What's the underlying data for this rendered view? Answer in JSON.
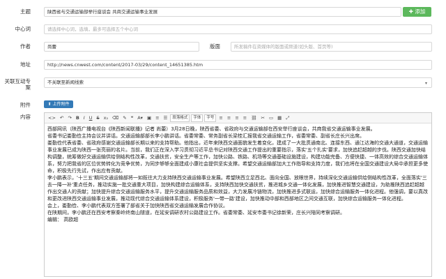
{
  "labels": {
    "title": "主题",
    "keywords": "中心词",
    "author": "作者",
    "layout": "版面",
    "url": "地址",
    "related": "关联互动专\n案",
    "attachment": "附件",
    "content": "内容"
  },
  "fields": {
    "title_value": "陕西省与交通运输部举行座谈会 共商交通运输事业发展",
    "keywords_placeholder": "请选择中心词，选填，最多可选择五个中心词",
    "author_value": "尚蕾",
    "layout_placeholder": "所发稿件在资媒体的版面或频道(如头版、首页等)",
    "url_value": "http://news.cnwest.com/content/2017-03/29/content_14651385.htm",
    "related_value": "不关联至新闻线索"
  },
  "buttons": {
    "add": "添加",
    "upload": "上传附件"
  },
  "toolbar": {
    "para_format": "段落格式",
    "font_family": "字体",
    "font_size": "字号"
  },
  "content": {
    "paragraphs": [
      "西部网讯（陕西广播电视台《陕西新闻联播》记者 尚蕾）3月28日晚，陕西省委、省政府与交通运输部在西安举行座谈会，共商我省交通运输事业发展。",
      "省委书记娄勤俭主持会议并讲话。交通运输部部长李小鹏讲话。省委常委、常务副省长梁桂汇报我省交通运输工作，省委常委、副省长庄长兴出席。",
      "娄勤俭代表省委、省政府感谢交通运输部长期以来的支持帮助。他指出，近年来陕西交通面貌发生着变化，建成了一大批贯通南北、连接东西、通江达海的交通大通道，交通运输事业发展已成为陕西一张亮丽的名片。当前，我们正在深入学习贯彻习近平总书记对陕西交通工作提出的重要指示，落实'五个扎实'要求，加快追赶超越的步伐。陕西交通加快结构调整，统筹做好交通运输供给侧结构性改革，交通扶贫，安全生产等工作，加快公路、铁路、机场等交通基础设施建设，构建功能完备、方便快捷、一体高效的综合交通运输体系，努力把我省的区位优势转化为竞争优势，为同步够够全面建成小康社会提供坚实支撑。希望交通运输部加大工作指导和支持力度，我们也将在全国交通建设大局中承担更多使命，积极先行先试，作出应有贡献。",
      "李小鹏表示，'十三五'期间交通运输部将一如既往大力支持陕西交通运输事业发展。希望陕西立足西北、面向全国、放眼世界，持续深化交通运输供给侧结构性改革，全面落实'三去一降一补'重点任务，推动实施一批交通重大项目，加快构建综合运输体系，支持陕西加快交通扶贫，推进城乡交通一体化发展，加快推进智慧交通建设，为助推陕西追赶超越作出交通人的贡献；加快提升综合交通运输服务水平，提升交通运输服务品质和效益，大力发展冷链物流，加快推进多式联运，加快综合运输服务一体化进程。他强调，要以真改和更改进陕西交通运输事业发展，推动现代综合交通运输体系建设，积极服务'一带一路'建设，加快推动中部和西部地区之间交通互联，加快综合运输服务一体化进程。",
      "会上，娄勤俭、李小鹏代表双方签署了部省关于加快陕西省交通运输发展合作协议。",
      "在陕期间，李小鹏还在西安考察秦岭终南山隧道，在延安调研农村公路建设工作。省委常委、延安市委书记徐新荣，庄长兴陪同考察调研。",
      "编辑： 高欧超"
    ]
  },
  "colors": {
    "add_green": "#5cb85c",
    "upload_blue": "#337ab7"
  }
}
